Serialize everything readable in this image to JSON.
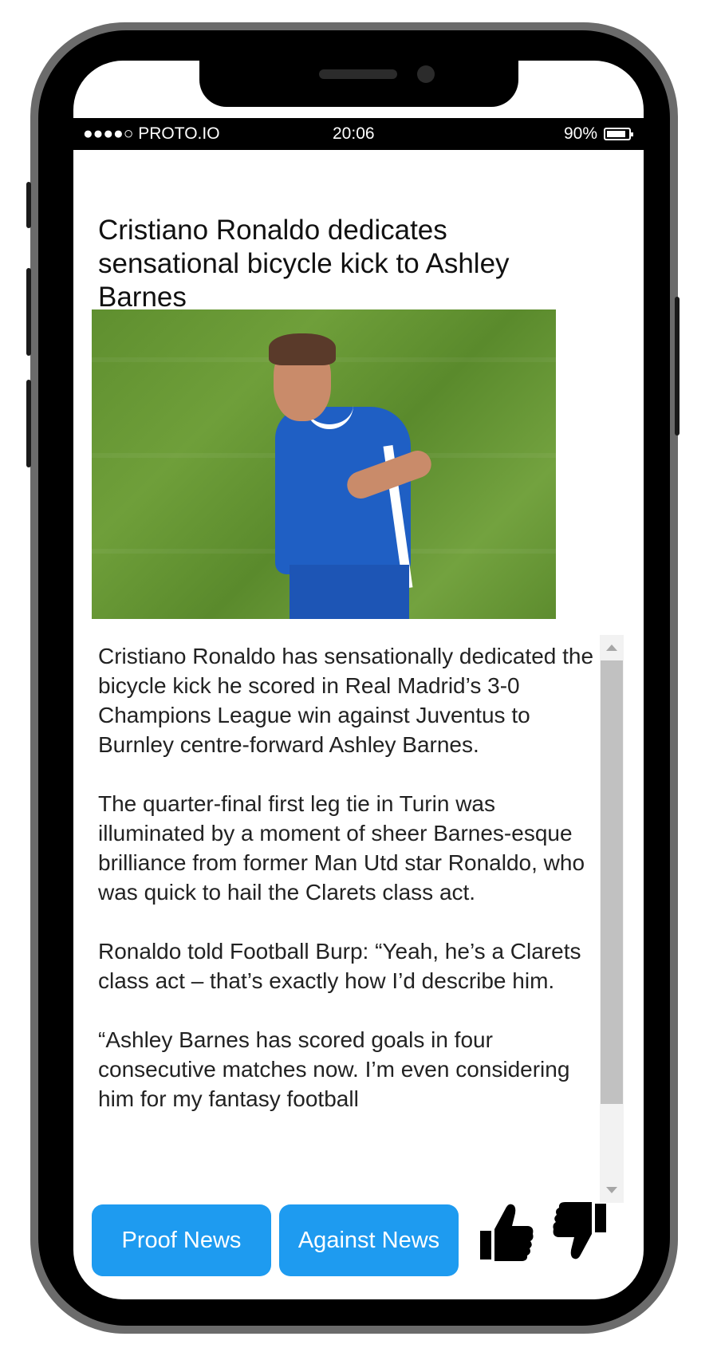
{
  "status_bar": {
    "carrier": "●●●●○ PROTO.IO",
    "time": "20:06",
    "battery_label": "90%",
    "battery_level": 0.9
  },
  "article": {
    "headline": "Cristiano Ronaldo dedicates sensational bicycle kick to Ashley Barnes",
    "paragraphs": [
      "Cristiano Ronaldo has sensationally dedicated the bicycle kick he scored in Real Madrid’s 3-0 Champions League win against Juventus to Burnley centre-forward Ashley Barnes.",
      "The quarter-final first leg tie in Turin was illuminated by a moment of sheer Barnes-esque brilliance from former Man Utd star Ronaldo, who was quick to hail the Clarets class act.",
      "Ronaldo told Football Burp: “Yeah, he’s a Clarets class act – that’s exactly how I’d describe him.",
      "“Ashley Barnes has scored goals in four consecutive matches now. I’m even considering him for my fantasy football"
    ]
  },
  "actions": {
    "proof_label": "Proof News",
    "against_label": "Against News",
    "thumbs_up_icon": "thumbs-up-icon",
    "thumbs_down_icon": "thumbs-down-icon"
  },
  "colors": {
    "button_bg": "#1e9bf0",
    "button_text": "#ffffff"
  }
}
